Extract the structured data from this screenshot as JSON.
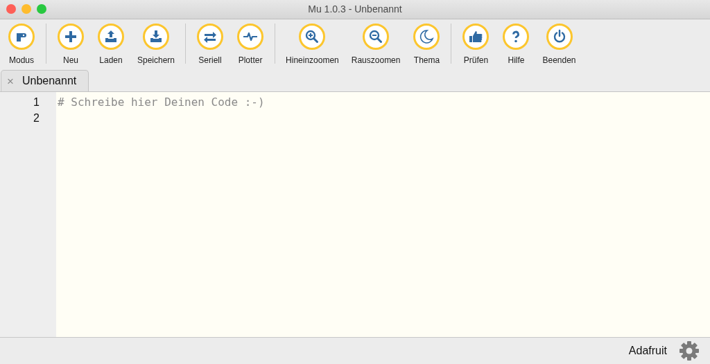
{
  "window": {
    "title": "Mu 1.0.3 - Unbenannt"
  },
  "toolbar": {
    "groups": [
      [
        {
          "label": "Modus",
          "kind": "mode"
        }
      ],
      [
        {
          "label": "Neu",
          "kind": "new"
        },
        {
          "label": "Laden",
          "kind": "load"
        },
        {
          "label": "Speichern",
          "kind": "save"
        }
      ],
      [
        {
          "label": "Seriell",
          "kind": "serial"
        },
        {
          "label": "Plotter",
          "kind": "plotter"
        }
      ],
      [
        {
          "label": "Hineinzoomen",
          "kind": "zoomin"
        },
        {
          "label": "Rauszoomen",
          "kind": "zoomout"
        },
        {
          "label": "Thema",
          "kind": "theme"
        }
      ],
      [
        {
          "label": "Prüfen",
          "kind": "check"
        },
        {
          "label": "Hilfe",
          "kind": "help"
        },
        {
          "label": "Beenden",
          "kind": "quit"
        }
      ]
    ]
  },
  "tabs": [
    {
      "label": "Unbenannt",
      "selected": true,
      "close": "×"
    }
  ],
  "editor": {
    "lines": [
      {
        "number": "1",
        "text": "# Schreibe hier Deinen Code :-)"
      },
      {
        "number": "2"
      }
    ]
  },
  "status_bar": {
    "mode": "Adafruit"
  }
}
